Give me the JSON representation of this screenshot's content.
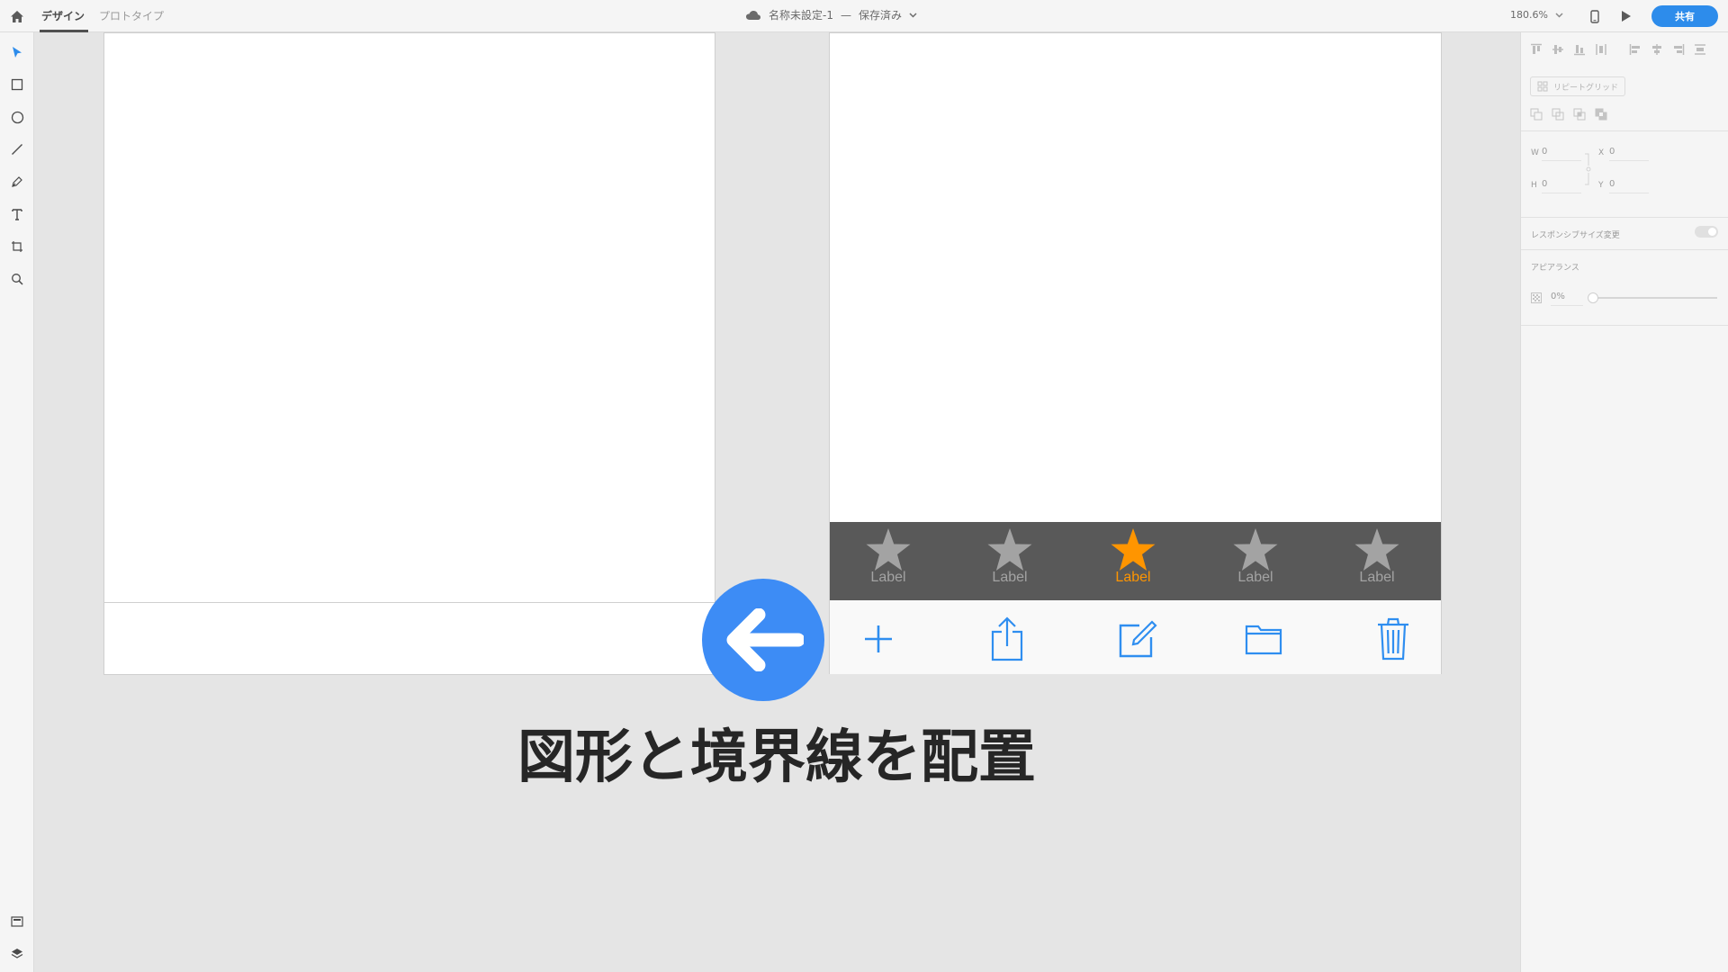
{
  "app": {
    "modes": {
      "design": "デザイン",
      "prototype": "プロトタイプ"
    },
    "document": {
      "title": "名称未設定-1",
      "separator": "—",
      "status": "保存済み"
    },
    "zoom": "180.6%",
    "share_label": "共有",
    "accent_color": "#2d8ceb"
  },
  "toolbar": {
    "tools": [
      "select-icon",
      "rectangle-icon",
      "ellipse-icon",
      "line-icon",
      "pen-icon",
      "text-icon",
      "artboard-icon",
      "zoom-icon"
    ],
    "bottom": [
      "assets-icon",
      "layers-icon"
    ]
  },
  "properties_panel": {
    "repeat_grid_label": "リピートグリッド",
    "w_label": "W",
    "w_value": "0",
    "h_label": "H",
    "h_value": "0",
    "x_label": "X",
    "x_value": "0",
    "y_label": "Y",
    "y_value": "0",
    "responsive_resize_label": "レスポンシブサイズ変更",
    "appearance_label": "アピアランス",
    "opacity_value": "0%"
  },
  "canvas": {
    "tab_bar": {
      "background": "#595959",
      "inactive_color": "#a3a3a3",
      "active_color": "#ff9500",
      "tabs": [
        {
          "label": "Label",
          "icon": "star-icon",
          "active": false
        },
        {
          "label": "Label",
          "icon": "star-icon",
          "active": false
        },
        {
          "label": "Label",
          "icon": "star-icon",
          "active": true
        },
        {
          "label": "Label",
          "icon": "star-icon",
          "active": false
        },
        {
          "label": "Label",
          "icon": "star-icon",
          "active": false
        }
      ]
    },
    "bottom_toolbar": {
      "icon_color": "#2f8ef0",
      "icons": [
        "add-icon",
        "share-icon",
        "compose-icon",
        "folder-icon",
        "trash-icon"
      ]
    }
  },
  "overlay": {
    "arrow_color": "#3d8cf5",
    "caption": "図形と境界線を配置"
  }
}
